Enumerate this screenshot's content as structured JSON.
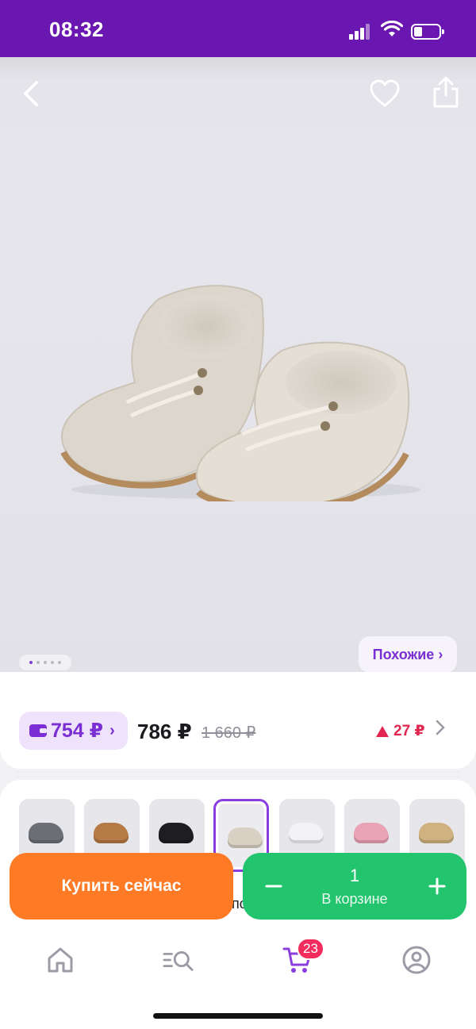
{
  "status_bar": {
    "time": "08:32"
  },
  "gallery": {
    "similar_label": "Похожие ›",
    "slide_count": 5,
    "active_slide": 1
  },
  "price": {
    "wallet_amount": "754 ₽",
    "wallet_chevron": "›",
    "current": "786 ₽",
    "old": "1 660 ₽",
    "change": "27 ₽",
    "change_color": "#e0264f"
  },
  "variants": {
    "items": [
      {
        "name": "grey",
        "color": "#6b6e74"
      },
      {
        "name": "brown",
        "color": "#b57a45"
      },
      {
        "name": "black",
        "color": "#1e1d22"
      },
      {
        "name": "beige",
        "color": "#d9d1c3",
        "selected": true
      },
      {
        "name": "white",
        "color": "#f3f3f6"
      },
      {
        "name": "pink",
        "color": "#e9a3b4"
      },
      {
        "name": "sand",
        "color": "#cfb27f"
      }
    ],
    "partial_text": "по"
  },
  "actions": {
    "buy_label": "Купить сейчас",
    "cart_qty": "1",
    "cart_label": "В корзине"
  },
  "bottom_nav": {
    "cart_badge": "23"
  },
  "colors": {
    "brand_purple": "#6a16b0",
    "accent_purple": "#7a2ed4",
    "buy_orange": "#ff7a24",
    "cart_green": "#22c46e",
    "badge_red": "#f22c5c"
  }
}
